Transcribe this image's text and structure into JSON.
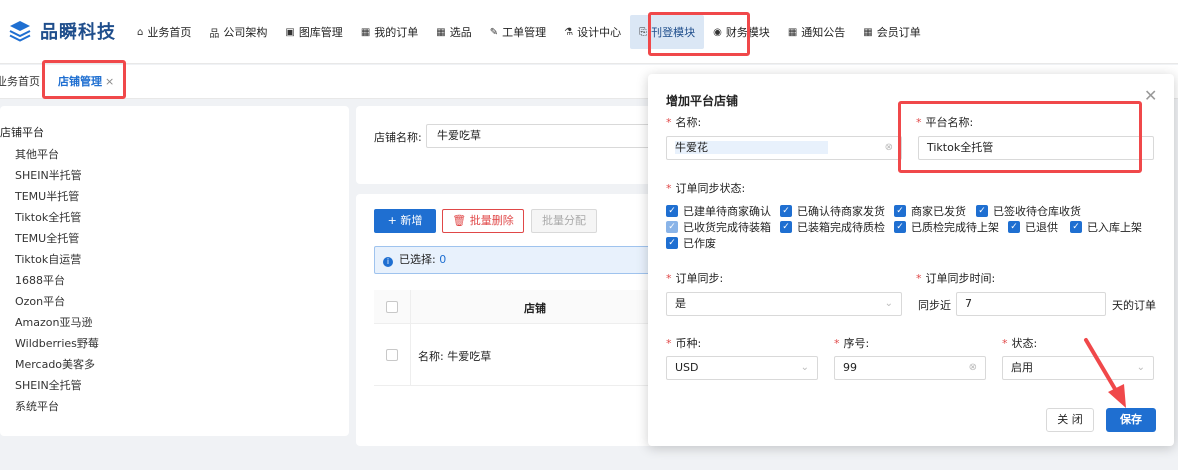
{
  "app": {
    "title": "品瞬科技"
  },
  "nav": {
    "items": [
      {
        "icon": "home-icon",
        "glyph": "⌂",
        "label": "业务首页"
      },
      {
        "icon": "org-icon",
        "glyph": "品",
        "label": "公司架构"
      },
      {
        "icon": "image-icon",
        "glyph": "▣",
        "label": "图库管理"
      },
      {
        "icon": "grid-icon",
        "glyph": "▦",
        "label": "我的订单"
      },
      {
        "icon": "grid-icon",
        "glyph": "▦",
        "label": "选品"
      },
      {
        "icon": "edit-icon",
        "glyph": "✎",
        "label": "工单管理"
      },
      {
        "icon": "flask-icon",
        "glyph": "⚗",
        "label": "设计中心"
      },
      {
        "icon": "listing-icon",
        "glyph": "⎘",
        "label": "刊登模块"
      },
      {
        "icon": "finance-icon",
        "glyph": "◉",
        "label": "财务模块"
      },
      {
        "icon": "grid-icon",
        "glyph": "▦",
        "label": "通知公告"
      },
      {
        "icon": "grid-icon",
        "glyph": "▦",
        "label": "会员订单"
      }
    ],
    "active_index": 7
  },
  "tabs": {
    "home": "业务首页",
    "shop": "店铺管理",
    "close": "×"
  },
  "tree": {
    "root": "店铺平台",
    "children": [
      "其他平台",
      "SHEIN半托管",
      "TEMU半托管",
      "Tiktok全托管",
      "TEMU全托管",
      "Tiktok自运营",
      "1688平台",
      "Ozon平台",
      "Amazon亚马逊",
      "Wildberries野莓",
      "Mercado美客多",
      "SHEIN全托管",
      "系统平台"
    ]
  },
  "filter": {
    "label": "店铺名称:",
    "value": "牛爱吃草"
  },
  "toolbar": {
    "add": "+ 新增",
    "delete": "🗑 批量删除",
    "assign": "批量分配"
  },
  "selection": {
    "info": "i",
    "label": "已选择:",
    "count": "0"
  },
  "table": {
    "header": "店铺",
    "row_name": "名称: 牛爱吃草"
  },
  "modal": {
    "title": "增加平台店铺",
    "close": "✕",
    "name_label": "名称:",
    "name_value": "牛爱花",
    "name_clear": "⊗",
    "platform_label": "平台名称:",
    "platform_value": "Tiktok全托管",
    "sync_status_label": "订单同步状态:",
    "statuses": [
      "已建单待商家确认",
      "已确认待商家发货",
      "商家已发货",
      "已签收待仓库收货",
      "已收货完成待装箱",
      "已装箱完成待质检",
      "已质检完成待上架",
      "已退供",
      "已入库上架",
      "已作废"
    ],
    "order_sync_label": "订单同步:",
    "order_sync_value": "是",
    "sync_time_label": "订单同步时间:",
    "sync_prefix": "同步近",
    "sync_days": "7",
    "sync_suffix": "天的订单",
    "currency_label": "币种:",
    "currency_value": "USD",
    "seq_label": "序号:",
    "seq_value": "99",
    "state_label": "状态:",
    "state_value": "启用",
    "btn_close": "关 闭",
    "btn_save": "保存"
  },
  "colors": {
    "accent": "#1f6fd1",
    "highlight": "#f0484a",
    "danger": "#e04848"
  }
}
